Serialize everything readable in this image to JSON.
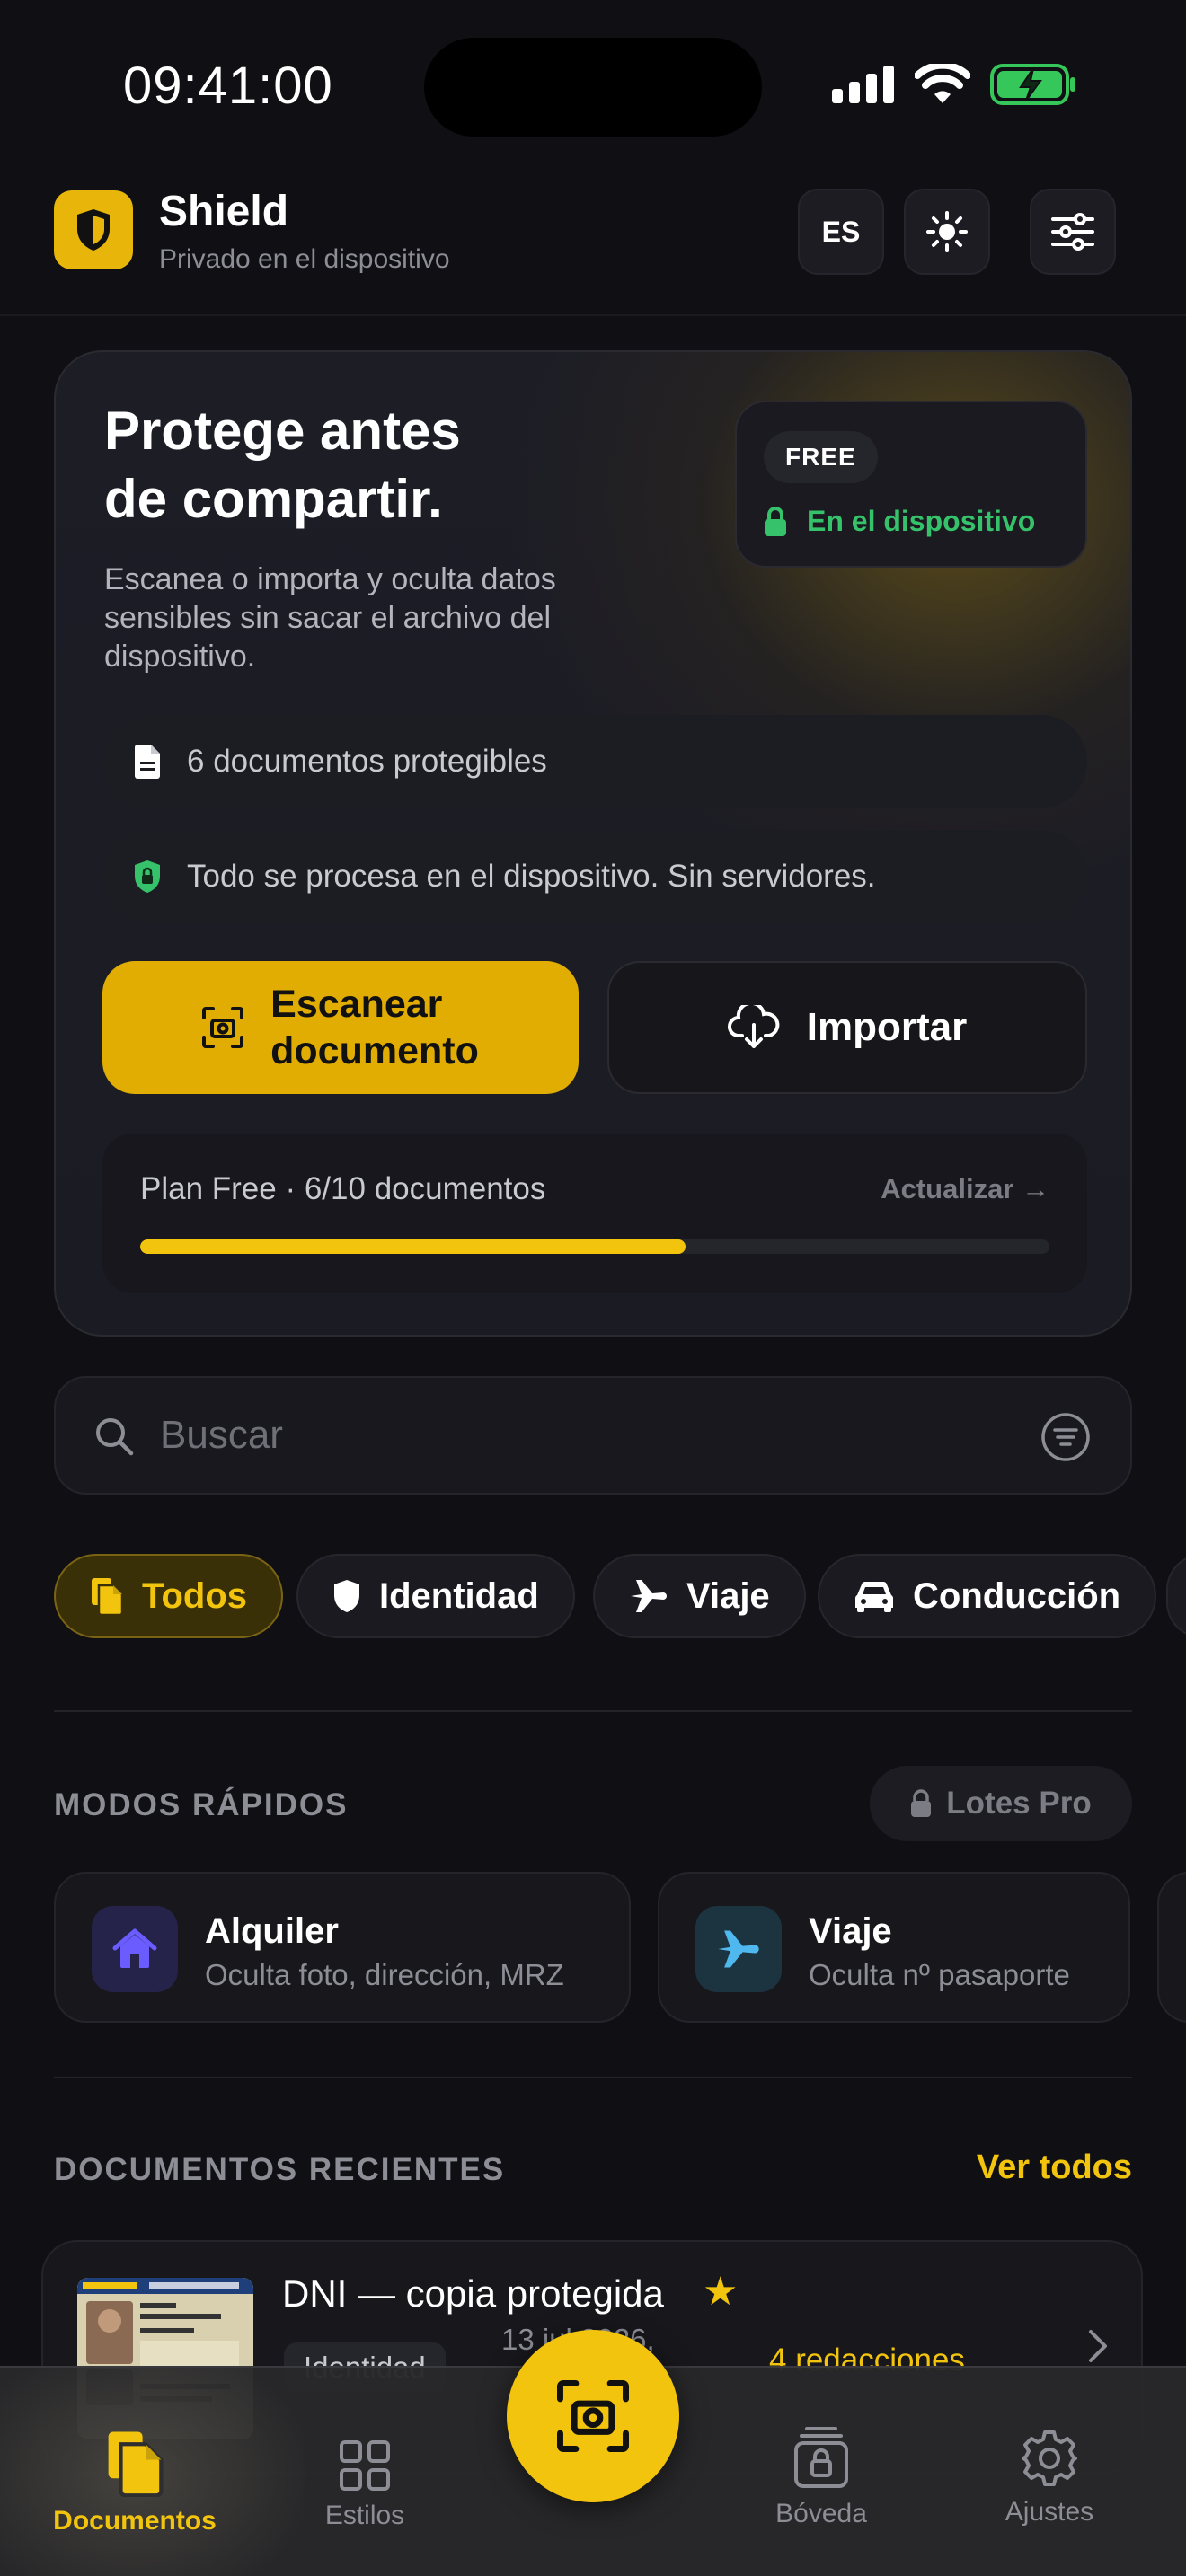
{
  "status_bar": {
    "time": "09:41:00"
  },
  "header": {
    "title": "Shield",
    "subtitle": "Privado en el dispositivo",
    "language": "ES"
  },
  "hero": {
    "title_line1": "Protege antes",
    "title_line2": "de compartir.",
    "description": "Escanea o importa y oculta datos sensibles sin sacar el archivo del dispositivo.",
    "plan_badge": "FREE",
    "on_device": "En el dispositivo",
    "protectable_docs": "6 documentos protegibles",
    "privacy_note": "Todo se procesa en el dispositivo. Sin servidores.",
    "scan_label": "Escanear\ndocumento",
    "import_label": "Importar",
    "plan_text": "Plan Free · 6/10 documentos",
    "plan_upgrade": "Actualizar →",
    "plan_progress": 0.6
  },
  "search": {
    "placeholder": "Buscar"
  },
  "filters": [
    {
      "label": "Todos",
      "active": true
    },
    {
      "label": "Identidad",
      "active": false
    },
    {
      "label": "Viaje",
      "active": false
    },
    {
      "label": "Conducción",
      "active": false
    }
  ],
  "quick_modes": {
    "heading": "MODOS RÁPIDOS",
    "batch_label": "Lotes Pro",
    "items": [
      {
        "title": "Alquiler",
        "subtitle": "Oculta foto, dirección, MRZ",
        "icon": "house-icon",
        "color": "#6a5cff"
      },
      {
        "title": "Viaje",
        "subtitle": "Oculta nº pasaporte",
        "icon": "plane-icon",
        "color": "#4fb8ee"
      }
    ]
  },
  "recent": {
    "heading": "DOCUMENTOS RECIENTES",
    "see_all": "Ver todos",
    "items": [
      {
        "title": "DNI — copia protegida",
        "tag": "Identidad",
        "date": "13 jul 2026,",
        "redactions": "4 redacciones",
        "starred": true
      }
    ]
  },
  "tabbar": {
    "tabs": [
      {
        "label": "Documentos",
        "icon": "documents-icon",
        "active": true
      },
      {
        "label": "Estilos",
        "icon": "grid-icon",
        "active": false
      },
      {
        "label": "Bóveda",
        "icon": "vault-icon",
        "active": false
      },
      {
        "label": "Ajustes",
        "icon": "gear-icon",
        "active": false
      }
    ]
  },
  "colors": {
    "accent": "#f2c40d",
    "success": "#36c26a",
    "background": "#101014"
  }
}
